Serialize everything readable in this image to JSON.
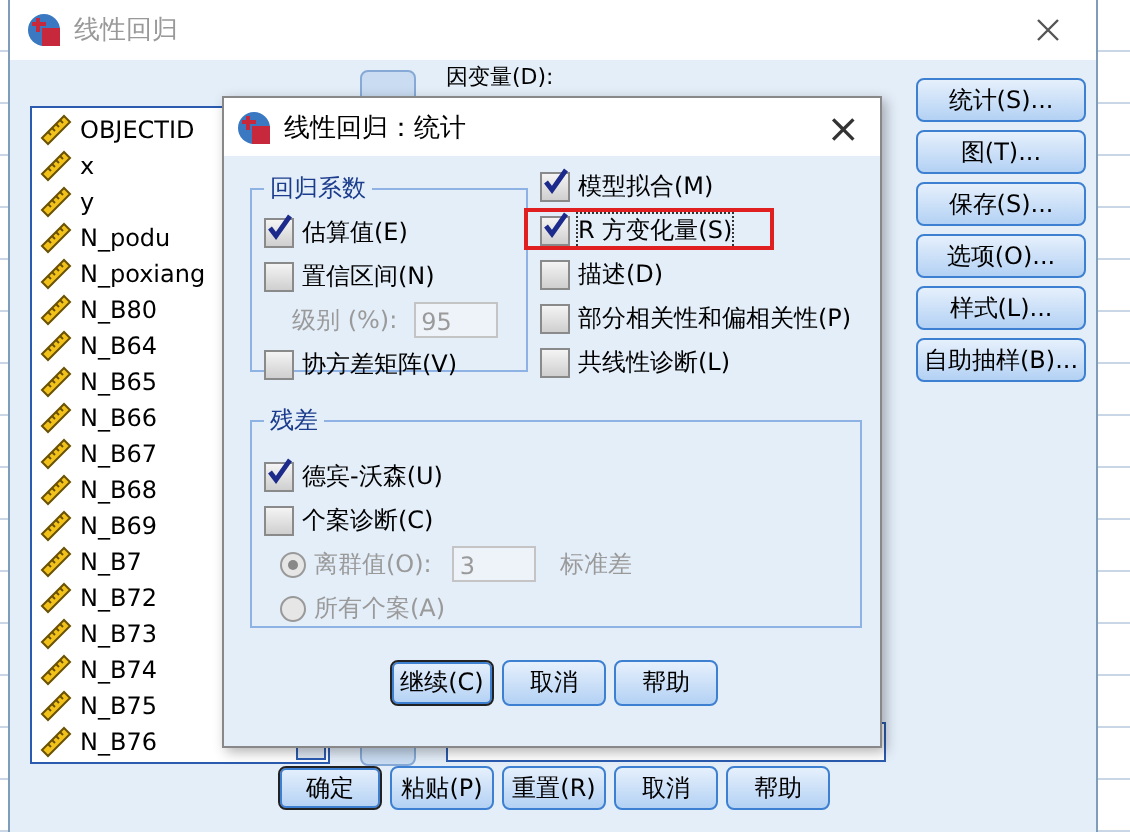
{
  "outer_window": {
    "title": "线性回归",
    "dependent_label": "因变量(D):",
    "variables": [
      {
        "name": "OBJECTID"
      },
      {
        "name": "x"
      },
      {
        "name": "y"
      },
      {
        "name": "N_podu"
      },
      {
        "name": "N_poxiang"
      },
      {
        "name": "N_B80"
      },
      {
        "name": "N_B64"
      },
      {
        "name": "N_B65"
      },
      {
        "name": "N_B66"
      },
      {
        "name": "N_B67"
      },
      {
        "name": "N_B68"
      },
      {
        "name": "N_B69"
      },
      {
        "name": "N_B7"
      },
      {
        "name": "N_B72"
      },
      {
        "name": "N_B73"
      },
      {
        "name": "N_B74"
      },
      {
        "name": "N_B75"
      },
      {
        "name": "N_B76"
      }
    ],
    "side_buttons": [
      {
        "label": "统计(S)..."
      },
      {
        "label": "图(T)..."
      },
      {
        "label": "保存(S)..."
      },
      {
        "label": "选项(O)..."
      },
      {
        "label": "样式(L)..."
      },
      {
        "label": "自助抽样(B)..."
      }
    ],
    "bottom_buttons": [
      {
        "label": "确定",
        "default": true
      },
      {
        "label": "粘贴(P)",
        "default": false
      },
      {
        "label": "重置(R)",
        "default": false
      },
      {
        "label": "取消",
        "default": false
      },
      {
        "label": "帮助",
        "default": false
      }
    ]
  },
  "dialog": {
    "title": "线性回归：统计",
    "close": "×",
    "coefficients_group": {
      "title": "回归系数",
      "options": [
        {
          "kind": "checkbox",
          "label": "估算值(E)",
          "checked": true
        },
        {
          "kind": "checkbox",
          "label": "置信区间(N)",
          "checked": false
        },
        {
          "kind": "level",
          "label": "级别 (%):",
          "value": "95",
          "disabled": true
        },
        {
          "kind": "checkbox",
          "label": "协方差矩阵(V)",
          "checked": false
        }
      ]
    },
    "options": [
      {
        "label": "模型拟合(M)",
        "checked": true,
        "highlighted": false,
        "focused": false
      },
      {
        "label": "R 方变化量(S)",
        "checked": true,
        "highlighted": true,
        "focused": true
      },
      {
        "label": "描述(D)",
        "checked": false,
        "highlighted": false,
        "focused": false
      },
      {
        "label": "部分相关性和偏相关性(P)",
        "checked": false,
        "highlighted": false,
        "focused": false
      },
      {
        "label": "共线性诊断(L)",
        "checked": false,
        "highlighted": false,
        "focused": false
      }
    ],
    "residuals_group": {
      "title": "残差",
      "options": [
        {
          "kind": "checkbox",
          "label": "德宾-沃森(U)",
          "checked": true
        },
        {
          "kind": "checkbox",
          "label": "个案诊断(C)",
          "checked": false
        },
        {
          "kind": "radio",
          "label": "离群值(O):",
          "value": "3",
          "unit": "标准差",
          "selected": true,
          "disabled": true
        },
        {
          "kind": "radio",
          "label": "所有个案(A)",
          "selected": false,
          "disabled": true
        }
      ]
    },
    "buttons": [
      {
        "label": "继续(C)",
        "default": true
      },
      {
        "label": "取消",
        "default": false
      },
      {
        "label": "帮助",
        "default": false
      }
    ]
  }
}
